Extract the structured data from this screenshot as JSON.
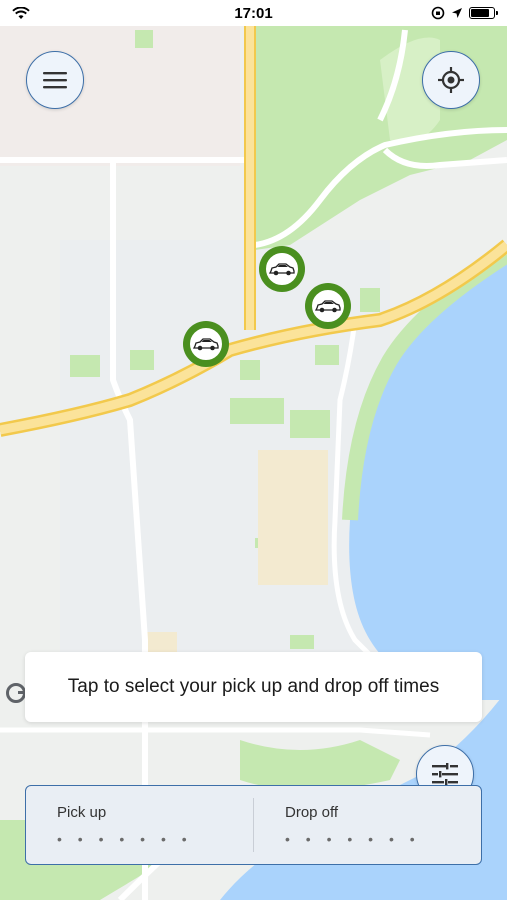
{
  "status_bar": {
    "time": "17:01",
    "battery_level": 0.85
  },
  "map": {
    "menu_button": {
      "icon": "hamburger-menu-icon"
    },
    "locate_button": {
      "icon": "my-location-icon"
    },
    "vehicles": [
      {
        "name": "car-marker-1"
      },
      {
        "name": "car-marker-2"
      },
      {
        "name": "car-marker-3"
      }
    ],
    "filter_button": {
      "icon": "sliders-icon"
    }
  },
  "hint": {
    "text": "Tap to select your pick up and drop off times"
  },
  "times": {
    "pickup_label": "Pick up",
    "pickup_value": "• • • • • • •",
    "dropoff_label": "Drop off",
    "dropoff_value": "• • • • • • •"
  },
  "colors": {
    "accent": "#3d6fa8",
    "vehicle": "#4a8f1f",
    "water": "#aad3fc",
    "park": "#c5e8b0",
    "road": "#f7d77a"
  }
}
